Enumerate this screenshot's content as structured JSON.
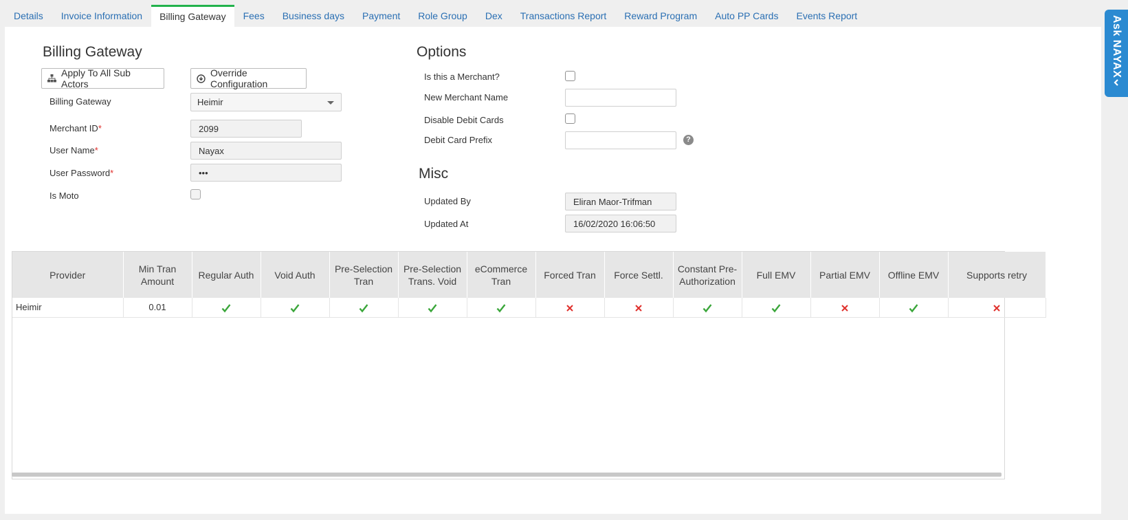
{
  "tabs": [
    "Details",
    "Invoice Information",
    "Billing Gateway",
    "Fees",
    "Business days",
    "Payment",
    "Role Group",
    "Dex",
    "Transactions Report",
    "Reward Program",
    "Auto PP Cards",
    "Events Report"
  ],
  "active_tab": "Billing Gateway",
  "billing": {
    "title": "Billing Gateway",
    "apply_all_label": "Apply To All Sub Actors",
    "override_label": "Override Configuration",
    "gateway_label": "Billing Gateway",
    "gateway_value": "Heimir",
    "merchant_id_label": "Merchant ID",
    "merchant_id_value": "2099",
    "user_name_label": "User Name",
    "user_name_value": "Nayax",
    "password_label": "User Password",
    "password_value": "•••",
    "is_moto_label": "Is Moto",
    "required_mark": "*"
  },
  "options": {
    "title": "Options",
    "is_merchant_label": "Is this a Merchant?",
    "new_merchant_name_label": "New Merchant Name",
    "new_merchant_name_value": "",
    "disable_debit_label": "Disable Debit Cards",
    "debit_prefix_label": "Debit Card Prefix",
    "debit_prefix_value": "",
    "help_glyph": "?"
  },
  "misc": {
    "title": "Misc",
    "updated_by_label": "Updated By",
    "updated_by_value": "Eliran Maor-Trifman",
    "updated_at_label": "Updated At",
    "updated_at_value": "16/02/2020 16:06:50"
  },
  "table": {
    "headers": [
      "Provider",
      "Min Tran Amount",
      "Regular Auth",
      "Void Auth",
      "Pre-Selection Tran",
      "Pre-Selection Trans. Void",
      "eCommerce Tran",
      "Forced Tran",
      "Force Settl.",
      "Constant Pre-Authorization",
      "Full EMV",
      "Partial EMV",
      "Offline EMV",
      "Supports retry"
    ],
    "rows": [
      {
        "provider": "Heimir",
        "min_tran_amount": "0.01",
        "flags": [
          true,
          true,
          true,
          true,
          true,
          false,
          false,
          true,
          true,
          false,
          true,
          false
        ]
      }
    ]
  },
  "ask_nayax": {
    "label": "Ask NAYAX"
  },
  "colors": {
    "accent_green": "#22b24c",
    "link_blue": "#2a6fb3",
    "check_green": "#3aa63a",
    "cross_red": "#e0302c",
    "ask_blue": "#2b8ad1"
  }
}
